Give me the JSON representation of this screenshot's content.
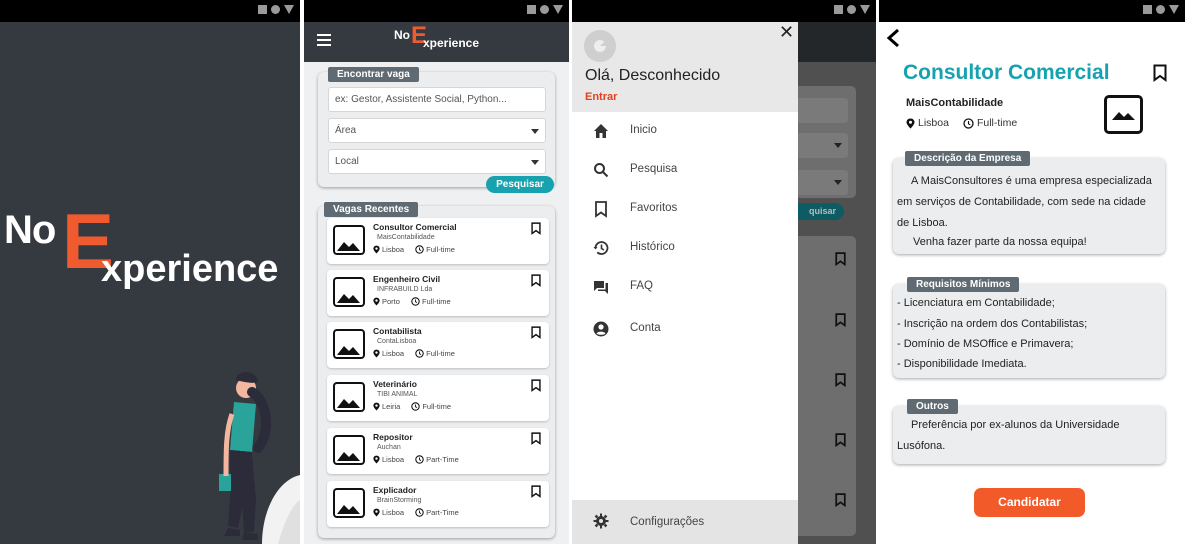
{
  "brand": {
    "logo_no": "No",
    "logo_e": "E",
    "logo_rest": "xperience",
    "accent_orange": "#ef5a2f",
    "accent_teal": "#17a2b0",
    "dark_bg": "#353a40"
  },
  "search": {
    "section_label": "Encontrar vaga",
    "keyword_placeholder": "ex: Gestor, Assistente Social, Python...",
    "area_label": "Área",
    "local_label": "Local",
    "search_button": "Pesquisar"
  },
  "recent": {
    "section_label": "Vagas Recentes",
    "jobs": [
      {
        "title": "Consultor Comercial",
        "company": "MaisContabilidade",
        "location": "Lisboa",
        "type": "Full-time"
      },
      {
        "title": "Engenheiro Civil",
        "company": "INFRABUILD Lda",
        "location": "Porto",
        "type": "Full-time"
      },
      {
        "title": "Contabilista",
        "company": "ContaLisboa",
        "location": "Lisboa",
        "type": "Full-time"
      },
      {
        "title": "Veterinário",
        "company": "TIBI ANIMAL",
        "location": "Leiria",
        "type": "Full-time"
      },
      {
        "title": "Repositor",
        "company": "Auchan",
        "location": "Lisboa",
        "type": "Part-Time"
      },
      {
        "title": "Explicador",
        "company": "BrainStorming",
        "location": "Lisboa",
        "type": "Part-Time"
      }
    ]
  },
  "drawer": {
    "greeting": "Olá, Desconhecido",
    "login_link": "Entrar",
    "close_glyph": "✕",
    "items": [
      {
        "label": "Inicio",
        "icon": "home-icon"
      },
      {
        "label": "Pesquisa",
        "icon": "search-icon"
      },
      {
        "label": "Favoritos",
        "icon": "bookmark-icon"
      },
      {
        "label": "Histórico",
        "icon": "history-icon"
      },
      {
        "label": "FAQ",
        "icon": "forum-icon"
      },
      {
        "label": "Conta",
        "icon": "account-icon"
      }
    ],
    "settings_label": "Configurações",
    "dimmed_button": "quisar"
  },
  "detail": {
    "title": "Consultor Comercial",
    "company": "MaisContabilidade",
    "location": "Lisboa",
    "type": "Full-time",
    "description_label": "Descrição da Empresa",
    "description_lines": [
      "A MaisConsultores é uma empresa especializada",
      "em serviços de Contabilidade, com sede na cidade",
      "de Lisboa.",
      "Venha fazer parte da nossa equipa!"
    ],
    "requirements_label": "Requisitos Mínimos",
    "requirements": [
      "- Licenciatura em Contabilidade;",
      "- Inscrição na ordem dos Contabilistas;",
      "- Domínio de MSOffice e Primavera;",
      "- Disponibilidade Imediata."
    ],
    "others_label": "Outros",
    "others_lines": [
      "Preferência por ex-alunos da Universidade",
      "Lusófona."
    ],
    "apply_button": "Candidatar"
  }
}
